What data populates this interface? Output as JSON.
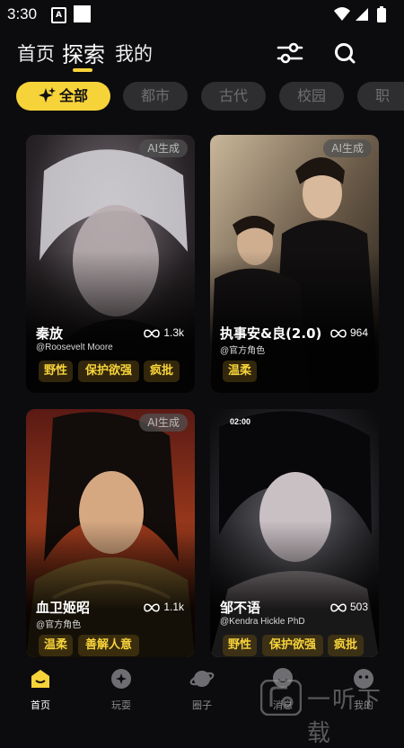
{
  "status": {
    "time": "3:30"
  },
  "nav": {
    "tabs": [
      "首页",
      "探索",
      "我的"
    ],
    "active": 1
  },
  "chips": [
    "全部",
    "都市",
    "古代",
    "校园",
    "职"
  ],
  "cards": [
    {
      "ai": "AI生成",
      "name": "秦放",
      "author": "@Roosevelt Moore",
      "count": "1.3k",
      "tags": [
        "野性",
        "保护欲强",
        "疯批"
      ]
    },
    {
      "ai": "AI生成",
      "name": "执事安&良(2.0)",
      "author": "@官方角色",
      "count": "964",
      "tags": [
        "温柔"
      ]
    },
    {
      "ai": "AI生成",
      "name": "血卫姬昭",
      "author": "@官方角色",
      "count": "1.1k",
      "tags": [
        "温柔",
        "善解人意"
      ]
    },
    {
      "ai": "02:00",
      "name": "邹不语",
      "author": "@Kendra Hickle PhD",
      "count": "503",
      "tags": [
        "野性",
        "保护欲强",
        "疯批"
      ]
    }
  ],
  "bottom_tabs": [
    "首页",
    "玩耍",
    "圈子",
    "消息",
    "我的"
  ],
  "watermark": "一听下载",
  "colors": {
    "accent": "#f7d33a",
    "background": "#0c0c0e"
  }
}
